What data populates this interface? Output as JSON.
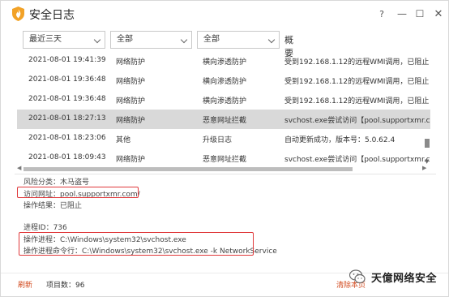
{
  "window": {
    "title": "安全日志",
    "help_glyph": "?",
    "min_glyph": "—",
    "max_glyph": "☐",
    "close_glyph": "✕"
  },
  "filters": {
    "time": "最近三天",
    "category": "全部",
    "type": "全部",
    "summary_header": "概要"
  },
  "rows": [
    {
      "time": "2021-08-01 19:41:39",
      "category": "网络防护",
      "type": "横向渗透防护",
      "summary": "受到192.168.1.12的远程WMI调用，已阻止",
      "selected": false
    },
    {
      "time": "2021-08-01 19:36:48",
      "category": "网络防护",
      "type": "横向渗透防护",
      "summary": "受到192.168.1.12的远程WMI调用，已阻止",
      "selected": false
    },
    {
      "time": "2021-08-01 19:36:48",
      "category": "网络防护",
      "type": "横向渗透防护",
      "summary": "受到192.168.1.12的远程WMI调用，已阻止",
      "selected": false
    },
    {
      "time": "2021-08-01 18:27:13",
      "category": "网络防护",
      "type": "恶意网址拦截",
      "summary": "svchost.exe尝试访问【pool.supportxmr.com/",
      "selected": true
    },
    {
      "time": "2021-08-01 18:23:06",
      "category": "其他",
      "type": "升级日志",
      "summary": "自动更新成功，版本号：5.0.62.4",
      "selected": false
    },
    {
      "time": "2021-08-01 18:09:43",
      "category": "网络防护",
      "type": "恶意网址拦截",
      "summary": "svchost.exe尝试访问【pool.supportxmr.com/",
      "selected": false
    }
  ],
  "detail": {
    "risk": "风险分类：木马盗号",
    "url": "访问网址：pool.supportxmr.com/",
    "result": "操作结果：已阻止",
    "pid": "进程ID：736",
    "process": "操作进程：C:\\Windows\\system32\\svchost.exe",
    "cmdline": "操作进程命令行：C:\\Windows\\system32\\svchost.exe -k NetworkService"
  },
  "footer": {
    "refresh": "刷新",
    "count": "项目数：96",
    "clear": "清除本页"
  },
  "watermark": {
    "text": "天億网络安全"
  },
  "colors": {
    "accent": "#d24a1e",
    "highlight_box": "#e0393b",
    "selected_row": "#d9d9d9"
  }
}
